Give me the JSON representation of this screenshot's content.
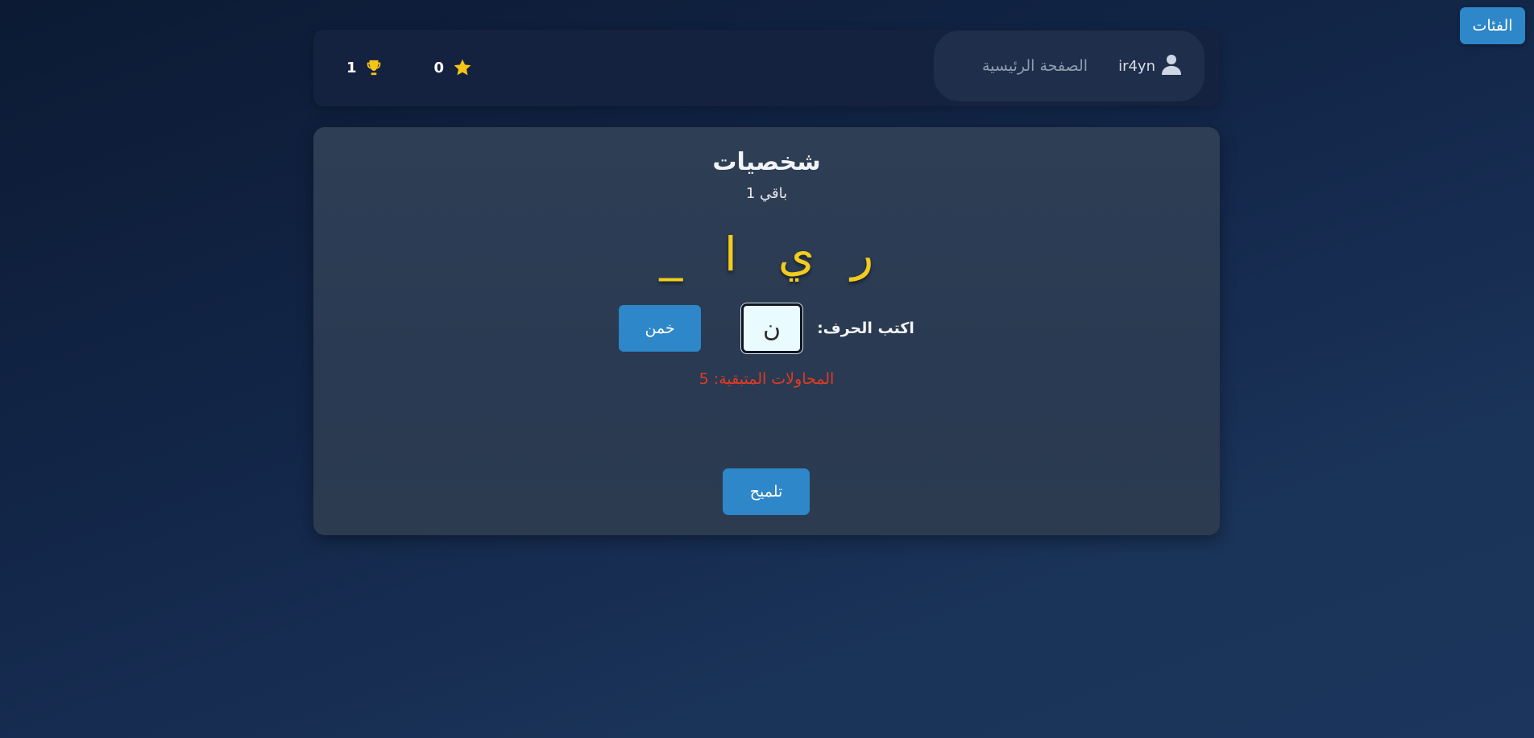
{
  "header": {
    "categories_label": "الفئات",
    "home_label": "الصفحة الرئيسية",
    "username": "ir4yn",
    "stats": {
      "score": "0",
      "trophies": "1"
    }
  },
  "game": {
    "category_title": "شخصيات",
    "remaining_text": "باقي 1",
    "word_letters": [
      "ر",
      "ي",
      "ا",
      "_"
    ],
    "guess_label": "اكتب الحرف:",
    "guess_value": "ن",
    "guess_button_label": "خمن",
    "attempts_text": "المحاولات المتبقية: 5",
    "hint_button_label": "تلميح"
  },
  "colors": {
    "accent": "#2d87c8",
    "letter": "#f2cc1e",
    "attempts": "#e33a22",
    "star": "#f5c518",
    "trophy": "#f5c518"
  },
  "icons": [
    "star-icon",
    "trophy-icon",
    "user-icon"
  ]
}
